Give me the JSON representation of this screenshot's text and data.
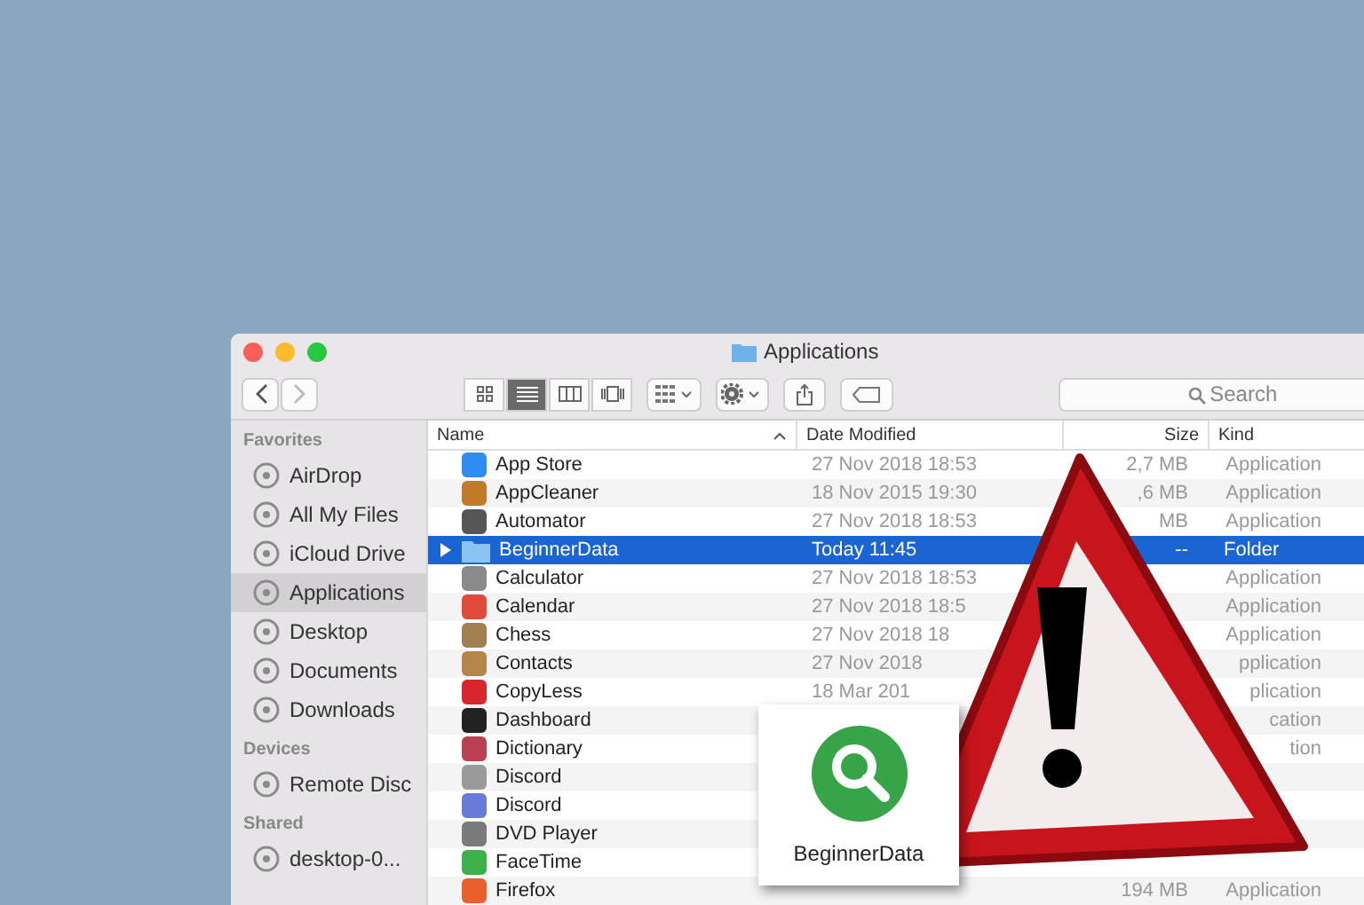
{
  "window": {
    "title": "Applications"
  },
  "toolbar": {
    "views": [
      {
        "selected": false
      },
      {
        "selected": true
      },
      {
        "selected": false
      },
      {
        "selected": false
      }
    ],
    "search": {
      "placeholder": "Search"
    }
  },
  "sidebar": {
    "sections": [
      {
        "title": "Favorites",
        "items": [
          {
            "label": "AirDrop",
            "selected": false
          },
          {
            "label": "All My Files",
            "selected": false
          },
          {
            "label": "iCloud Drive",
            "selected": false
          },
          {
            "label": "Applications",
            "selected": true
          },
          {
            "label": "Desktop",
            "selected": false
          },
          {
            "label": "Documents",
            "selected": false
          },
          {
            "label": "Downloads",
            "selected": false
          }
        ]
      },
      {
        "title": "Devices",
        "items": [
          {
            "label": "Remote Disc",
            "selected": false
          }
        ]
      },
      {
        "title": "Shared",
        "items": [
          {
            "label": "desktop-0...",
            "selected": false
          }
        ]
      }
    ]
  },
  "table": {
    "columns": [
      "Name",
      "Date Modified",
      "Size",
      "Kind"
    ],
    "rows": [
      {
        "name": "App Store",
        "kind": "app",
        "color": "#2f8cf0",
        "selected": false,
        "date": "27 Nov 2018 18:53",
        "size": "2,7 MB",
        "type": "Application"
      },
      {
        "name": "AppCleaner",
        "kind": "app",
        "color": "#c07a2a",
        "selected": false,
        "date": "18 Nov 2015 19:30",
        "size": ",6 MB",
        "type": "Application"
      },
      {
        "name": "Automator",
        "kind": "app",
        "color": "#555555",
        "selected": false,
        "date": "27 Nov 2018 18:53",
        "size": "MB",
        "type": "Application"
      },
      {
        "name": "BeginnerData",
        "kind": "folder",
        "color": "#8cc4f0",
        "selected": true,
        "date": "Today 11:45",
        "size": "--",
        "type": "Folder"
      },
      {
        "name": "Calculator",
        "kind": "app",
        "color": "#8a8a8a",
        "selected": false,
        "date": "27 Nov 2018 18:53",
        "type": "Application"
      },
      {
        "name": "Calendar",
        "kind": "app",
        "color": "#e04a3a",
        "selected": false,
        "date": "27 Nov 2018 18:5",
        "type": "Application"
      },
      {
        "name": "Chess",
        "kind": "app",
        "color": "#a08050",
        "selected": false,
        "date": "27 Nov 2018 18",
        "type": "Application"
      },
      {
        "name": "Contacts",
        "kind": "app",
        "color": "#b58448",
        "selected": false,
        "date": "27 Nov 2018",
        "type": "pplication"
      },
      {
        "name": "CopyLess",
        "kind": "app",
        "color": "#d8262e",
        "selected": false,
        "date": "18 Mar 201",
        "type": "plication"
      },
      {
        "name": "Dashboard",
        "kind": "app",
        "color": "#222222",
        "selected": false,
        "type": "cation"
      },
      {
        "name": "Dictionary",
        "kind": "app",
        "color": "#b84050",
        "selected": false,
        "type": "tion"
      },
      {
        "name": "Discord",
        "kind": "app",
        "color": "#9a9a9a",
        "selected": false
      },
      {
        "name": "Discord",
        "kind": "app",
        "color": "#6a7ad8",
        "selected": false
      },
      {
        "name": "DVD Player",
        "kind": "app",
        "color": "#7a7a7a",
        "selected": false
      },
      {
        "name": "FaceTime",
        "kind": "app",
        "color": "#3cb04a",
        "selected": false
      },
      {
        "name": "Firefox",
        "kind": "app",
        "color": "#e8602a",
        "selected": false,
        "size": "194 MB",
        "type": "Application"
      }
    ]
  },
  "popup": {
    "label": "BeginnerData"
  }
}
